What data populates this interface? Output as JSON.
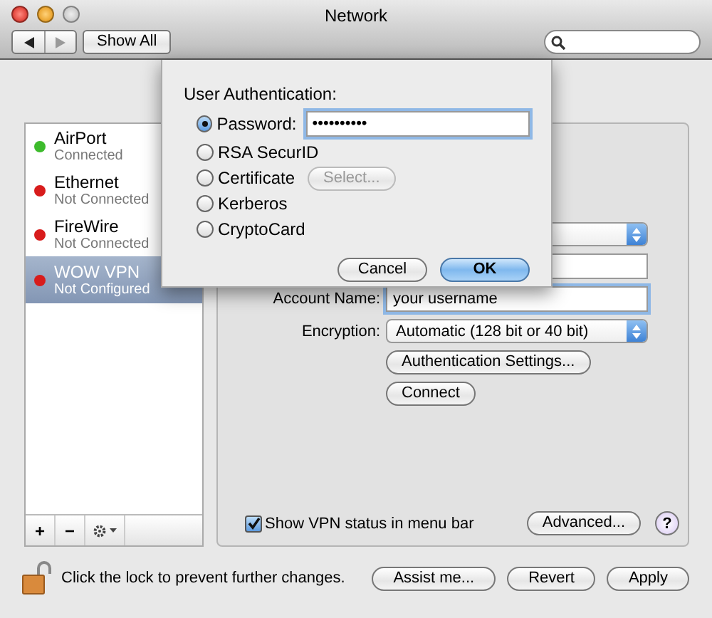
{
  "window": {
    "title": "Network"
  },
  "toolbar": {
    "show_all": "Show All"
  },
  "services": [
    {
      "name": "AirPort",
      "status": "Connected",
      "color": "#3dbb2c",
      "selected": false
    },
    {
      "name": "Ethernet",
      "status": "Not Connected",
      "color": "#d81c1c",
      "selected": false
    },
    {
      "name": "FireWire",
      "status": "Not Connected",
      "color": "#d81c1c",
      "selected": false
    },
    {
      "name": "WOW VPN",
      "status": "Not Configured",
      "color": "#d81c1c",
      "selected": true
    }
  ],
  "list_buttons": [
    "+",
    "−"
  ],
  "vpn": {
    "account_label": "Account Name:",
    "account_value": "your username",
    "encryption_label": "Encryption:",
    "encryption_value": "Automatic (128 bit or 40 bit)",
    "auth_settings": "Authentication Settings...",
    "connect": "Connect",
    "show_status": {
      "label": "Show VPN status in menu bar",
      "checked": true
    },
    "advanced": "Advanced...",
    "help": "?"
  },
  "footer": {
    "lock_text": "Click the lock to prevent further changes.",
    "buttons": [
      "Assist me...",
      "Revert",
      "Apply"
    ]
  },
  "sheet": {
    "title": "User Authentication:",
    "options": [
      {
        "label": "Password:",
        "selected": true,
        "kind": "field",
        "value": "••••••••••"
      },
      {
        "label": "RSA SecurID",
        "selected": false,
        "kind": "plain"
      },
      {
        "label": "Certificate",
        "selected": false,
        "kind": "button",
        "button": "Select...",
        "disabled": true
      },
      {
        "label": "Kerberos",
        "selected": false,
        "kind": "plain"
      },
      {
        "label": "CryptoCard",
        "selected": false,
        "kind": "plain"
      }
    ],
    "cancel": "Cancel",
    "ok": "OK"
  }
}
